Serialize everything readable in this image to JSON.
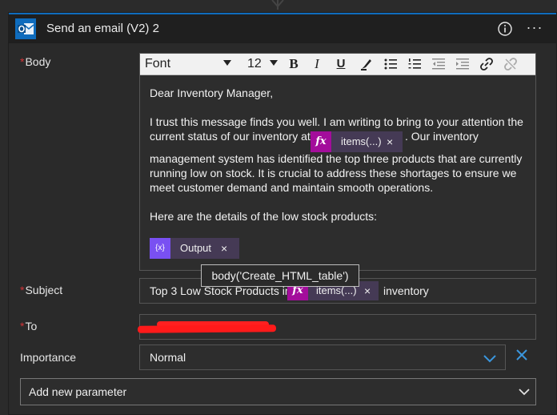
{
  "header": {
    "title": "Send an email (V2) 2",
    "info_icon": "info-circle-icon",
    "more_icon": "more-ellipsis-icon",
    "more_glyph": "···",
    "brand_color": "#0f6cbd"
  },
  "body_field": {
    "label": "Body",
    "required_mark": "*",
    "toolbar": {
      "font_value": "Font",
      "size_value": "12",
      "buttons": [
        "bold",
        "italic",
        "underline",
        "highlight",
        "bullet-list",
        "numbered-list",
        "decrease-indent",
        "increase-indent",
        "link",
        "unlink"
      ],
      "bold_glyph": "B",
      "italic_glyph": "I",
      "underline_glyph": "U"
    },
    "content": {
      "greeting": "Dear Inventory Manager,",
      "para1_before": "I trust this message finds you well. I am writing to bring to your attention the",
      "para1_line2_before": "current status of our inventory at",
      "para1_line2_after": ". Our inventory",
      "para2": "management system has identified the top three products that are currently running low on stock. It is crucial to address these shortages to ensure we meet customer demand and maintain smooth operations.",
      "para3": "Here are the details of the low stock products:",
      "token_items": {
        "icon": "fx",
        "label": "items(...)",
        "remove": "×"
      },
      "token_output": {
        "icon": "{x}",
        "label": "Output",
        "remove": "×"
      }
    }
  },
  "tooltip": {
    "text": "body('Create_HTML_table')"
  },
  "subject_field": {
    "label": "Subject",
    "required_mark": "*",
    "text_before": "Top 3 Low Stock Products in",
    "text_after": "inventory",
    "token_items": {
      "icon": "fx",
      "label": "items(...)",
      "remove": "×"
    }
  },
  "to_field": {
    "label": "To",
    "required_mark": "*",
    "value_redacted": true
  },
  "importance_field": {
    "label": "Importance",
    "selected": "Normal",
    "clear_icon": "close-x-icon"
  },
  "add_parameter": {
    "placeholder": "Add new parameter"
  },
  "colors": {
    "background": "#2b2b2b",
    "required": "#d13438",
    "fx_token": "#a30d9b",
    "var_token": "#7950f2",
    "token_bg": "#453a55",
    "accent": "#3a96dd"
  }
}
